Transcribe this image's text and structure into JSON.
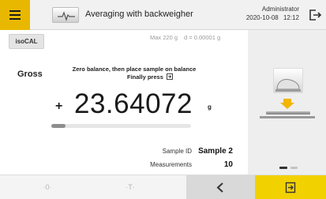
{
  "header": {
    "title": "Averaging with backweigher",
    "user": "Administrator",
    "date": "2020-10-08",
    "time": "12:12",
    "menu_icon": "hamburger-icon",
    "app_icon": "balance-task-icon",
    "logout_icon": "logout-icon"
  },
  "isocal": {
    "label": "isoCAL"
  },
  "weighing_range": {
    "max": "Max 220 g",
    "d": "d = 0.00001 g"
  },
  "mode_label": "Gross",
  "instruction": {
    "line1": "Zero balance, then place sample on balance",
    "line2": "Finally press",
    "icon": "confirm-icon"
  },
  "weight": {
    "sign": "+",
    "value": "23.64072",
    "unit": "g"
  },
  "capacity_progress": 0.1,
  "sample": {
    "id_label": "Sample ID",
    "id_value": "Sample 2"
  },
  "measurements": {
    "label": "Measurements",
    "value": "10"
  },
  "right_panel": {
    "illustration": "place-sample-on-pan-icon",
    "page_count": 2,
    "active_page": 1
  },
  "bottom_bar": {
    "zero_label": "·0·",
    "tare_label": "·T·",
    "back_icon": "chevron-left-icon",
    "next_icon": "confirm-icon"
  },
  "colors": {
    "accent_yellow": "#e8b800",
    "next_button": "#f2d100",
    "arrow_orange": "#f2b600",
    "panel_grey": "#eeeeee"
  }
}
